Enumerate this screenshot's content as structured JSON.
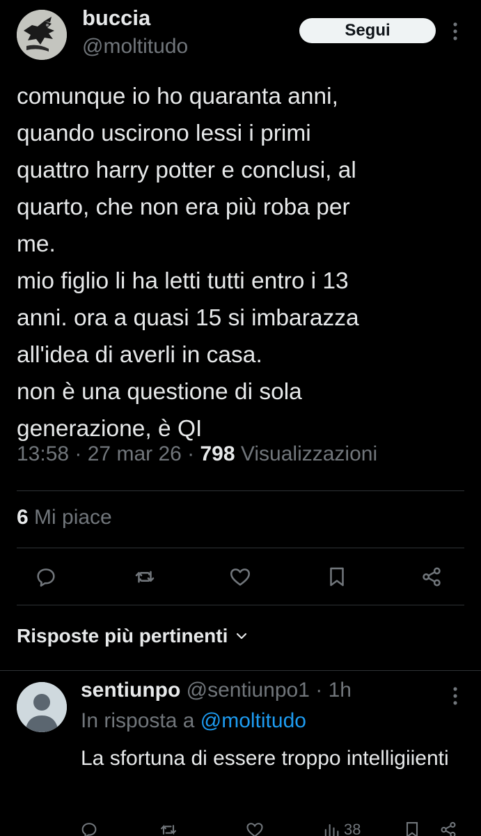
{
  "tweet": {
    "author_name": "buccia",
    "author_handle": "@moltitudo",
    "follow_label": "Segui",
    "text": "comunque io ho quaranta anni,\nquando uscirono lessi i primi\nquattro harry potter e conclusi, al\nquarto, che non era più roba per\nme.\nmio figlio li ha letti tutti entro i 13\nanni. ora a quasi 15 si imbarazza\nall'idea di averli in casa.\nnon è una questione di sola\ngenerazione, è QI",
    "time": "13:58",
    "date": "27 mar 26",
    "views_count": "798",
    "views_label": "Visualizzazioni",
    "likes_count": "6",
    "likes_label": "Mi piace"
  },
  "actions": [
    "reply-icon",
    "retweet-icon",
    "like-icon",
    "bookmark-icon",
    "share-icon"
  ],
  "replies_sort_label": "Risposte più pertinenti",
  "reply": {
    "author_name": "sentiunpo",
    "author_handle": "@sentiunpo1",
    "time_ago": "1h",
    "in_reply_label": "In risposta a",
    "mention": "@moltitudo",
    "text": "La sfortuna di essere troppo intelligiienti",
    "views_count": "38"
  },
  "colors": {
    "background": "#000000",
    "text": "#e7e9ea",
    "muted": "#71767b",
    "accent": "#1d9bf0",
    "divider": "#2f3336"
  }
}
